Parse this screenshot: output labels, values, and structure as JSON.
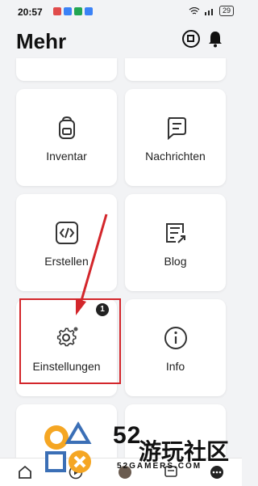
{
  "status_bar": {
    "time": "20:57",
    "battery": "29"
  },
  "header": {
    "title": "Mehr"
  },
  "tiles": [
    {
      "label": "Inventar"
    },
    {
      "label": "Nachrichten"
    },
    {
      "label": "Erstellen"
    },
    {
      "label": "Blog"
    },
    {
      "label": "Einstellungen",
      "badge": "1"
    },
    {
      "label": "Info"
    }
  ],
  "watermark": {
    "number": "52",
    "chinese": "游玩社区",
    "site": "52GAMERS.COM"
  },
  "colors": {
    "highlight": "#d3262b",
    "arrow": "#d3262b",
    "background": "#f2f3f5"
  }
}
